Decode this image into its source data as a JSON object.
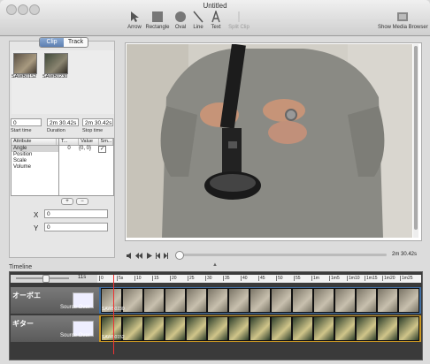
{
  "window": {
    "title": "Untitled"
  },
  "toolbar": {
    "tools": [
      {
        "label": "Arrow",
        "icon": "arrow-icon",
        "enabled": true
      },
      {
        "label": "Rectangle",
        "icon": "rectangle-icon",
        "enabled": true
      },
      {
        "label": "Oval",
        "icon": "oval-icon",
        "enabled": true
      },
      {
        "label": "Line",
        "icon": "line-icon",
        "enabled": true
      },
      {
        "label": "Text",
        "icon": "text-icon",
        "enabled": true
      },
      {
        "label": "Split Clip",
        "icon": "split-clip-icon",
        "enabled": false
      }
    ],
    "media_browser": {
      "label": "Show Media Browser",
      "icon": "media-browser-icon"
    }
  },
  "inspector": {
    "tabs": [
      {
        "label": "Clip",
        "selected": true
      },
      {
        "label": "Track",
        "selected": false
      }
    ],
    "clips": [
      {
        "name": "SAWB0152"
      },
      {
        "name": "SAWB0230"
      }
    ],
    "start_time": {
      "value": "0",
      "caption": "Start time"
    },
    "duration": {
      "value": "2m 30.42s",
      "caption": "Duration"
    },
    "stop_time": {
      "value": "2m 30.42s",
      "caption": "Stop time"
    },
    "attr_header": {
      "attribute": "Attribute",
      "t": "T...",
      "value": "Value",
      "sm": "Sm..."
    },
    "attributes": [
      "Angle",
      "Position",
      "Scale",
      "Volume"
    ],
    "position_row": {
      "t": "0",
      "value": "{0, 0}",
      "smooth": "✓"
    },
    "add_label": "+",
    "remove_label": "−",
    "x": {
      "label": "X",
      "value": "0"
    },
    "y": {
      "label": "Y",
      "value": "0"
    }
  },
  "viewer": {
    "time": "2m 30.42s",
    "progress": 0.0
  },
  "timeline": {
    "label": "Timeline",
    "zoom": "11s",
    "tracks": [
      {
        "name": "オーボエ",
        "blend": "Source Over",
        "clip": "SAWB0230",
        "color": "#4a7fb5"
      },
      {
        "name": "ギター",
        "blend": "Source Over",
        "clip": "SAWB0152",
        "color": "#d7a22a"
      }
    ],
    "ruler_ticks": [
      "0",
      "5s",
      "10",
      "15",
      "20",
      "25",
      "30",
      "35",
      "40",
      "45",
      "50",
      "55",
      "1m",
      "1m5",
      "1m10",
      "1m15",
      "1m20",
      "1m25"
    ]
  }
}
